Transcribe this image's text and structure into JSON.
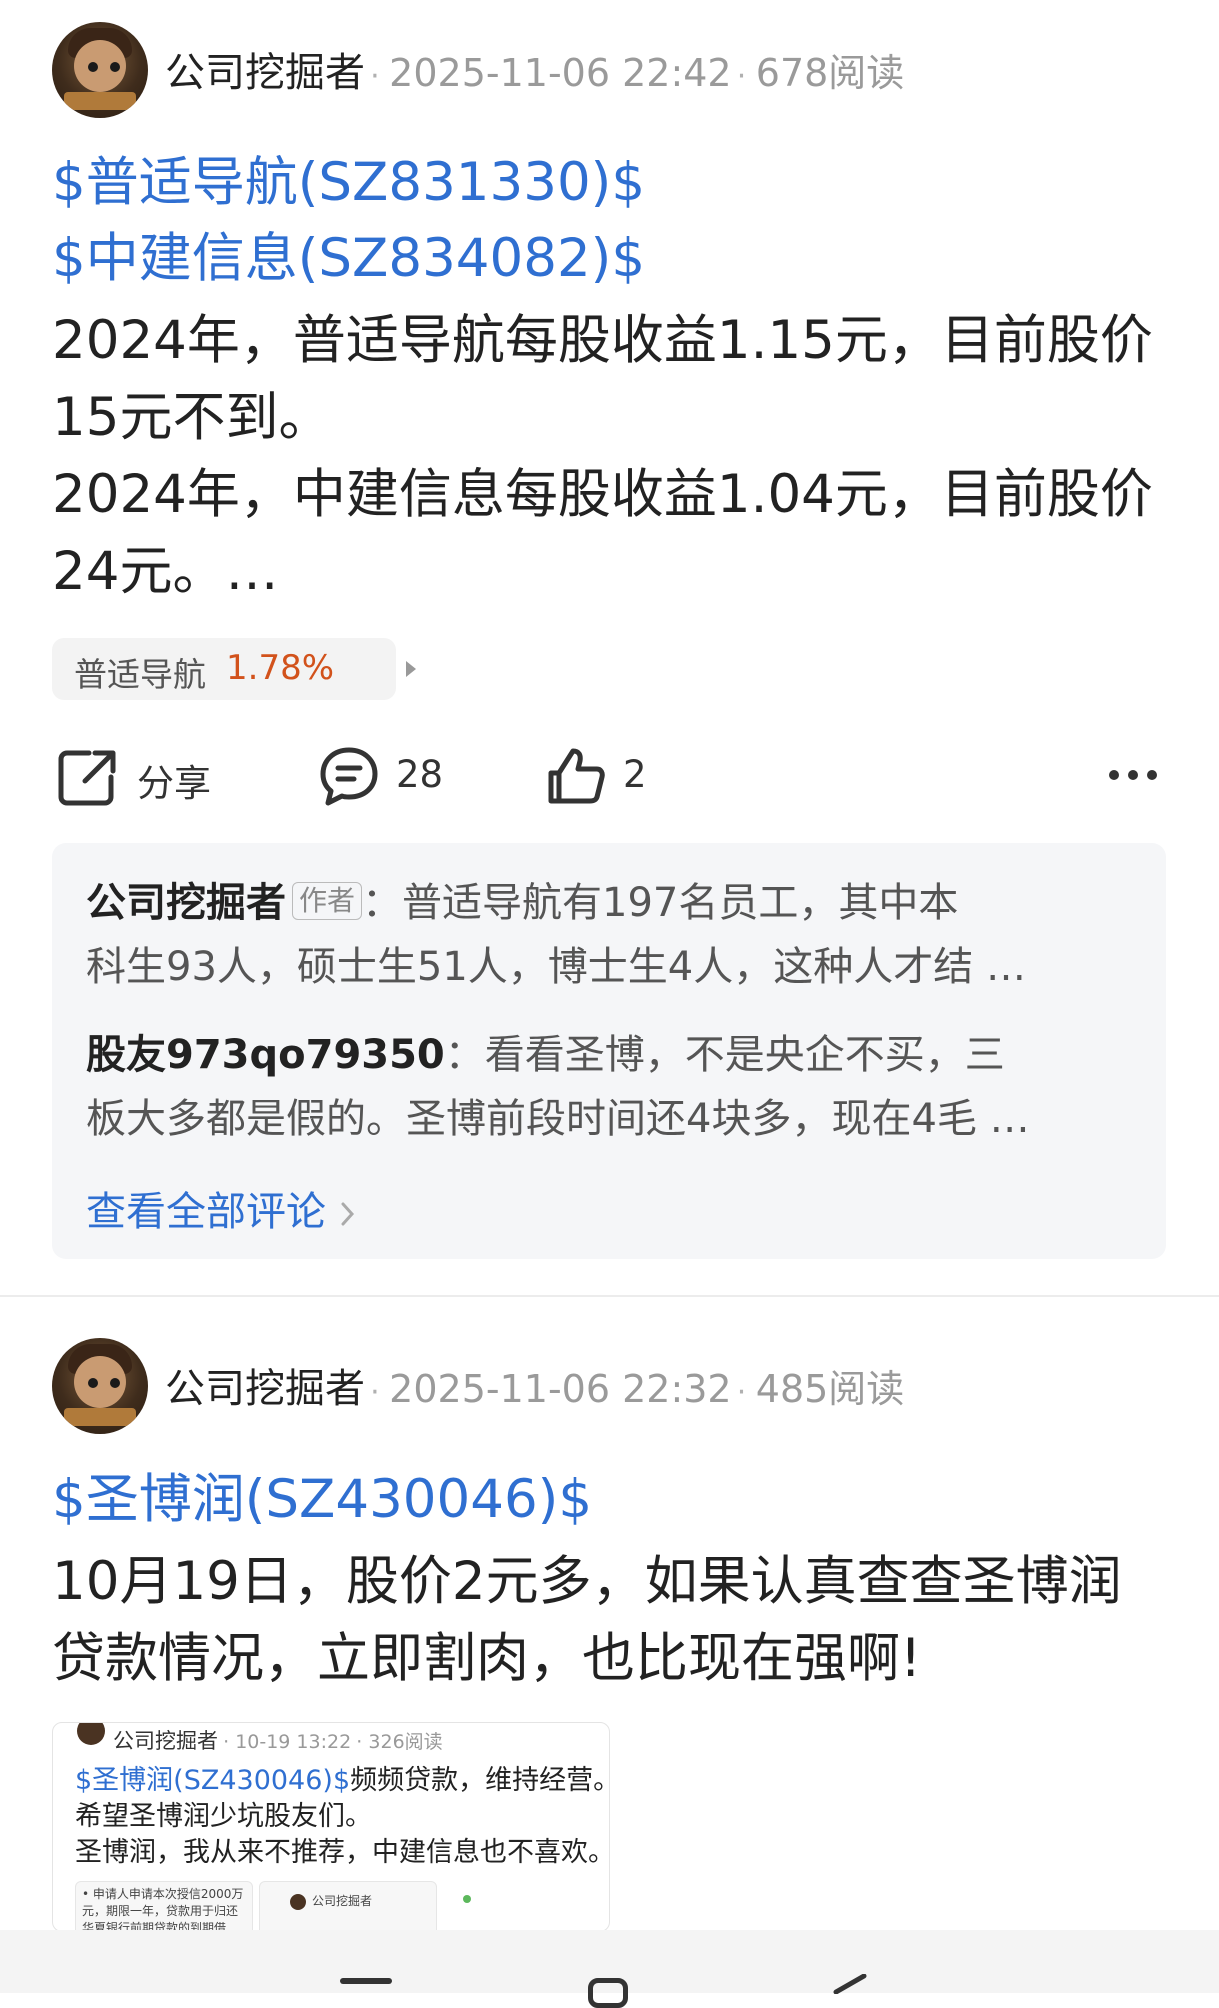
{
  "post1": {
    "author": "公司挖掘者",
    "datetime": "2025-11-06 22:42",
    "reads": "678阅读",
    "stocks": [
      "$普适导航(SZ831330)$",
      "$中建信息(SZ834082)$"
    ],
    "body_lines": [
      "2024年，普适导航每股收益1.15元，目前股价",
      "15元不到。",
      "2024年，中建信息每股收益1.04元，目前股价",
      "24元。…"
    ],
    "chip": {
      "name": "普适导航",
      "change": "1.78%"
    },
    "actions": {
      "share": "分享",
      "comments": "28",
      "likes": "2"
    },
    "comments": [
      {
        "name": "公司挖掘者",
        "tag": "作者",
        "line1": "：普适导航有197名员工，其中本",
        "line2": "科生93人，硕士生51人，博士生4人，这种人才结",
        "ellipsis": "…"
      },
      {
        "name": "股友973qo79350",
        "line1": "：看看圣博，不是央企不买，三",
        "line2": "板大多都是假的。圣博前段时间还4块多，现在4毛",
        "ellipsis": "…"
      }
    ],
    "view_all": "查看全部评论"
  },
  "post2": {
    "author": "公司挖掘者",
    "datetime": "2025-11-06 22:32",
    "reads": "485阅读",
    "stocks": [
      "$圣博润(SZ430046)$"
    ],
    "body_lines": [
      "10月19日，股价2元多，如果认真查查圣博润",
      "贷款情况，立即割肉，也比现在强啊!"
    ],
    "quote": {
      "author": "公司挖掘者",
      "datetime": "10-19 13:22",
      "reads": "326阅读",
      "stock": "$圣博润(SZ430046)$",
      "line1_rest": "频频贷款，维持经营。",
      "line2": "希望圣博润少坑股友们。",
      "line3": "圣博润，我从来不推荐，中建信息也不喜欢。",
      "thumb1_text": "• 申请人申请本次授信2000万元，期限一年，贷款用于归还华夏银行前期贷款的到期借款，担保方式北京中关村科技融资担保有限公司",
      "thumb2_author": "公司挖掘者"
    }
  },
  "icons": [
    "share-icon",
    "comment-icon",
    "like-icon",
    "more-icon",
    "chevron-right-icon"
  ],
  "colors": {
    "link": "#2f6fd1",
    "up": "#d2521b",
    "muted": "#9a9a9a"
  }
}
